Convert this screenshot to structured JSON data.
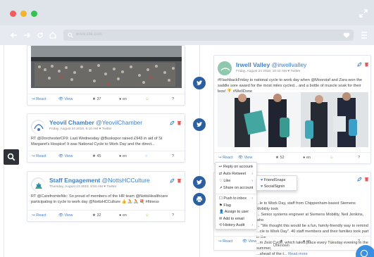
{
  "colors": {
    "accent": "#3e7fc7",
    "timeline": "#2c5fa0",
    "dot_red": "#f25c5c",
    "dot_yellow": "#f5b52a",
    "dot_green": "#35c24f"
  },
  "toolbar": {
    "url_placeholder": "www.site.com"
  },
  "cards_left": [
    {
      "type": "image-post",
      "actions": {
        "react": "React",
        "view": "View",
        "stars": "37",
        "lang": "en",
        "help": "?"
      }
    },
    {
      "account": "Yeovil Chamber",
      "handle": "@YeovilChamber",
      "meta": "Friday, August 24 2018, 6:10 AM ♥ Twitter",
      "text": "RT @DorchesterCF9: Last Wednesday @Buskspor raised £943 in aid of St Margaret's Hospice! It was National Cycle to Work Day and the direct...",
      "actions": {
        "react": "React",
        "view": "View",
        "stars": "45",
        "lang": "en",
        "help": "?"
      }
    },
    {
      "account": "Staff Engagement",
      "handle": "@NottsHCCulture",
      "meta": "Thursday, August 23 2018, 8:50 AM ♥ Twitter",
      "text": "RT @CarefromteNtc: So proud of members of the HR team @NottsHealthcare participating in cycle to work day @NottsHCCulture 👍 🚴 🚴 💐 #fitness",
      "actions": {
        "react": "React",
        "view": "View",
        "stars": "32",
        "lang": "en",
        "help": "?"
      }
    }
  ],
  "card_right": {
    "account": "Irwell Valley",
    "handle": "@irwellvalley",
    "meta": "Friday, August 24 2018, 10:42 AM ♥ Twitter",
    "text": "#FlashbackFriday to national cycle to work day when @Moorstaf and Zara won the saddle sore award for the most miles cycled... and a bottle of muscle soak for their legs! 🏆 #WellDone",
    "actions": {
      "react": "React",
      "view": "View",
      "stars": "52",
      "lang": "en",
      "help": "?"
    }
  },
  "card_right2": {
    "text": "...le to Work Day, staff from Chippenham-based Siemens Mobility took\n... Senior systems engineer at Siemens Mobility, Neil Jenkins, who\n... \"We thought this would be a fun, family-friendly way to remind\n...cle to Work Day\". 40 staff members and their families took part in the\n...m Zest Cycle, which takes place every Tuesday evening in the summer,\n...ahead of the t...",
    "read_more": "Read more",
    "actions": {
      "react": "React",
      "view": "View",
      "stars_label": "Unknown",
      "lang": "en",
      "help": "?"
    }
  },
  "context_menu": {
    "items": [
      {
        "label": "Reply on account",
        "has_sub": true,
        "icon": "reply-icon"
      },
      {
        "label": "Auto Retweet",
        "has_sub": true,
        "icon": "retweet-icon"
      },
      {
        "label": "Like",
        "has_sub": true,
        "icon": "heart-icon"
      },
      {
        "label": "Share on account",
        "has_sub": true,
        "icon": "share-icon"
      },
      {
        "label": "Push to inbox",
        "has_sub": true,
        "icon": "inbox-icon"
      },
      {
        "label": "Flag",
        "has_sub": false,
        "icon": "flag-icon"
      },
      {
        "label": "Assign to user",
        "has_sub": false,
        "icon": "user-icon"
      },
      {
        "label": "Add to email",
        "has_sub": false,
        "icon": "email-icon"
      },
      {
        "label": "History Audit",
        "has_sub": true,
        "icon": "history-icon"
      }
    ],
    "submenu": [
      "FriendSnaps",
      "SocialSignin"
    ]
  }
}
